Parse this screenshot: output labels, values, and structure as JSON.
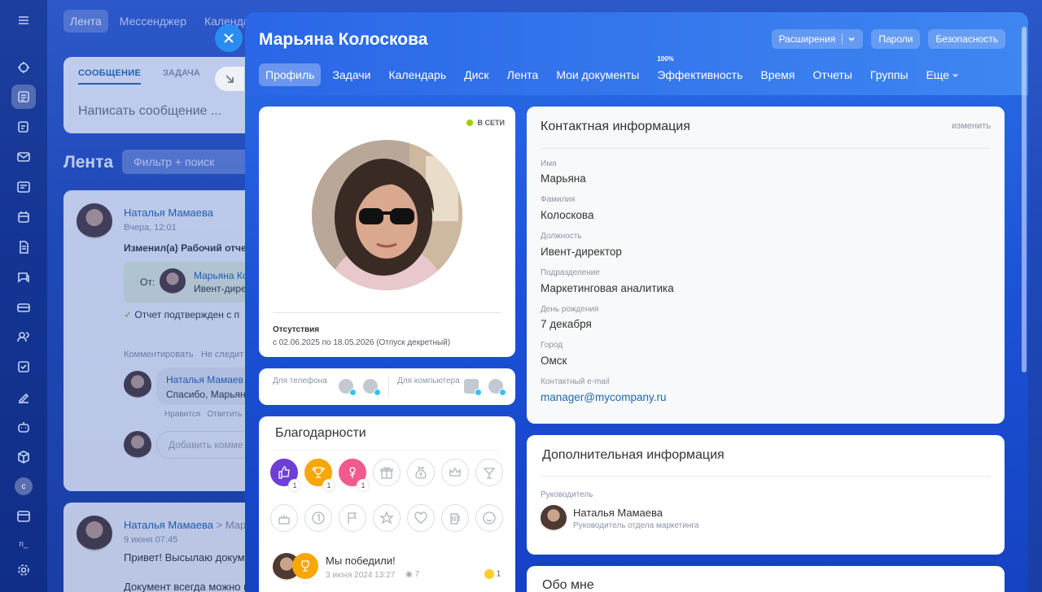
{
  "background": {
    "nav_tabs": [
      "Лента",
      "Мессенджер",
      "Календарь"
    ],
    "compose": {
      "tab_message": "СООБЩЕНИЕ",
      "tab_task": "ЗАДАЧА",
      "placeholder": "Написать сообщение ..."
    },
    "feed_title": "Лента",
    "filter_placeholder": "Фильтр + поиск",
    "post1": {
      "author": "Наталья Мамаева",
      "time": "Вчера, 12:01",
      "action": "Изменил(а) Рабочий отчет з",
      "from_label": "От:",
      "from_name": "Марьяна Ко",
      "from_role": "Ивент-дире",
      "confirmed": "Отчет подтвержден с п",
      "comment": "Комментировать",
      "unfollow": "Не следит",
      "reply_author": "Наталья Мамаев",
      "reply_text": "Спасибо, Марьян",
      "like": "Нравится",
      "answer": "Ответить",
      "add_comment": "Добавить комме"
    },
    "post2": {
      "author": "Наталья Мамаева",
      "arrow": ">",
      "target": "Мар",
      "time": "9 июня 07:45",
      "text": "Привет! Высылаю докуме",
      "text2": "Документ всегда можно н"
    },
    "rail_avatar_letter": "с",
    "rail_label": "п_"
  },
  "panel": {
    "title": "Марьяна Колоскова",
    "header_buttons": {
      "extensions": "Расширения",
      "passwords": "Пароли",
      "security": "Безопасность"
    },
    "tabs": [
      "Профиль",
      "Задачи",
      "Календарь",
      "Диск",
      "Лента",
      "Мои документы",
      "Эффективность",
      "Время",
      "Отчеты",
      "Группы",
      "Еще"
    ],
    "efficiency_badge": "100%",
    "active_tab": "Профиль"
  },
  "profile": {
    "status": "В СЕТИ",
    "absence_title": "Отсутствия",
    "absence_dates": "с 02.06.2025 по 18.05.2026 (Отпуск декретный)"
  },
  "apps": {
    "phone_label": "Для телефона",
    "desktop_label": "Для компьютера"
  },
  "thanks": {
    "title": "Благодарности",
    "badges_row1": [
      {
        "icon": "thumbs-up-icon",
        "color": "#6d3fd6",
        "count": "1"
      },
      {
        "icon": "trophy-icon",
        "color": "#f7a700",
        "count": "1"
      },
      {
        "icon": "flower-icon",
        "color": "#f05a8e",
        "count": "1"
      },
      {
        "icon": "gift-icon",
        "color": "",
        "count": ""
      },
      {
        "icon": "money-bag-icon",
        "color": "",
        "count": ""
      },
      {
        "icon": "crown-icon",
        "color": "",
        "count": ""
      },
      {
        "icon": "cocktail-icon",
        "color": "",
        "count": ""
      }
    ],
    "badges_row2": [
      "cake-icon",
      "number-one-icon",
      "flag-icon",
      "star-icon",
      "heart-icon",
      "beer-icon",
      "smile-icon"
    ],
    "item": {
      "text": "Мы победили!",
      "date": "3 июня 2024 13:27",
      "views": "7",
      "reactions": "1"
    }
  },
  "contact": {
    "title": "Контактная информация",
    "edit": "изменить",
    "fields": [
      {
        "label": "Имя",
        "value": "Марьяна"
      },
      {
        "label": "Фамилия",
        "value": "Колоскова"
      },
      {
        "label": "Должность",
        "value": "Ивент-директор"
      },
      {
        "label": "Подразделение",
        "value": "Маркетинговая аналитика"
      },
      {
        "label": "День рождения",
        "value": "7 декабря"
      },
      {
        "label": "Город",
        "value": "Омск"
      },
      {
        "label": "Контактный e-mail",
        "value": "manager@mycompany.ru"
      }
    ]
  },
  "additional": {
    "title": "Дополнительная информация",
    "manager_label": "Руководитель",
    "manager_name": "Наталья Мамаева",
    "manager_role": "Руководитель отдела маркетинга"
  },
  "about": {
    "title": "Обо мне"
  }
}
